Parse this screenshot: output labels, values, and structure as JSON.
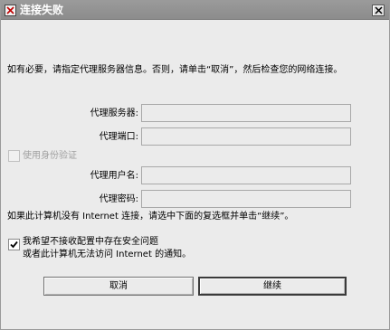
{
  "window": {
    "title": "连接失败"
  },
  "message": {
    "intro": "如有必要，请指定代理服务器信息。否则，请单击“取消”，然后检查您的网络连接。",
    "note": "如果此计算机没有 Internet 连接，请选中下面的复选框并单击“继续”。"
  },
  "form": {
    "proxy_server_label": "代理服务器:",
    "proxy_port_label": "代理端口:",
    "use_auth_label": "使用身份验证",
    "proxy_username_label": "代理用户名:",
    "proxy_password_label": "代理密码:",
    "proxy_server_value": "",
    "proxy_port_value": "",
    "proxy_username_value": "",
    "proxy_password_value": ""
  },
  "opt_out": {
    "line1": "我希望不接收配置中存在安全问题",
    "line2": "或者此计算机无法访问 Internet 的通知。",
    "checked": true
  },
  "buttons": {
    "cancel_label": "取消",
    "continue_label": "继续"
  },
  "icons": {
    "title": "warning-shield-icon",
    "close": "close-icon"
  }
}
